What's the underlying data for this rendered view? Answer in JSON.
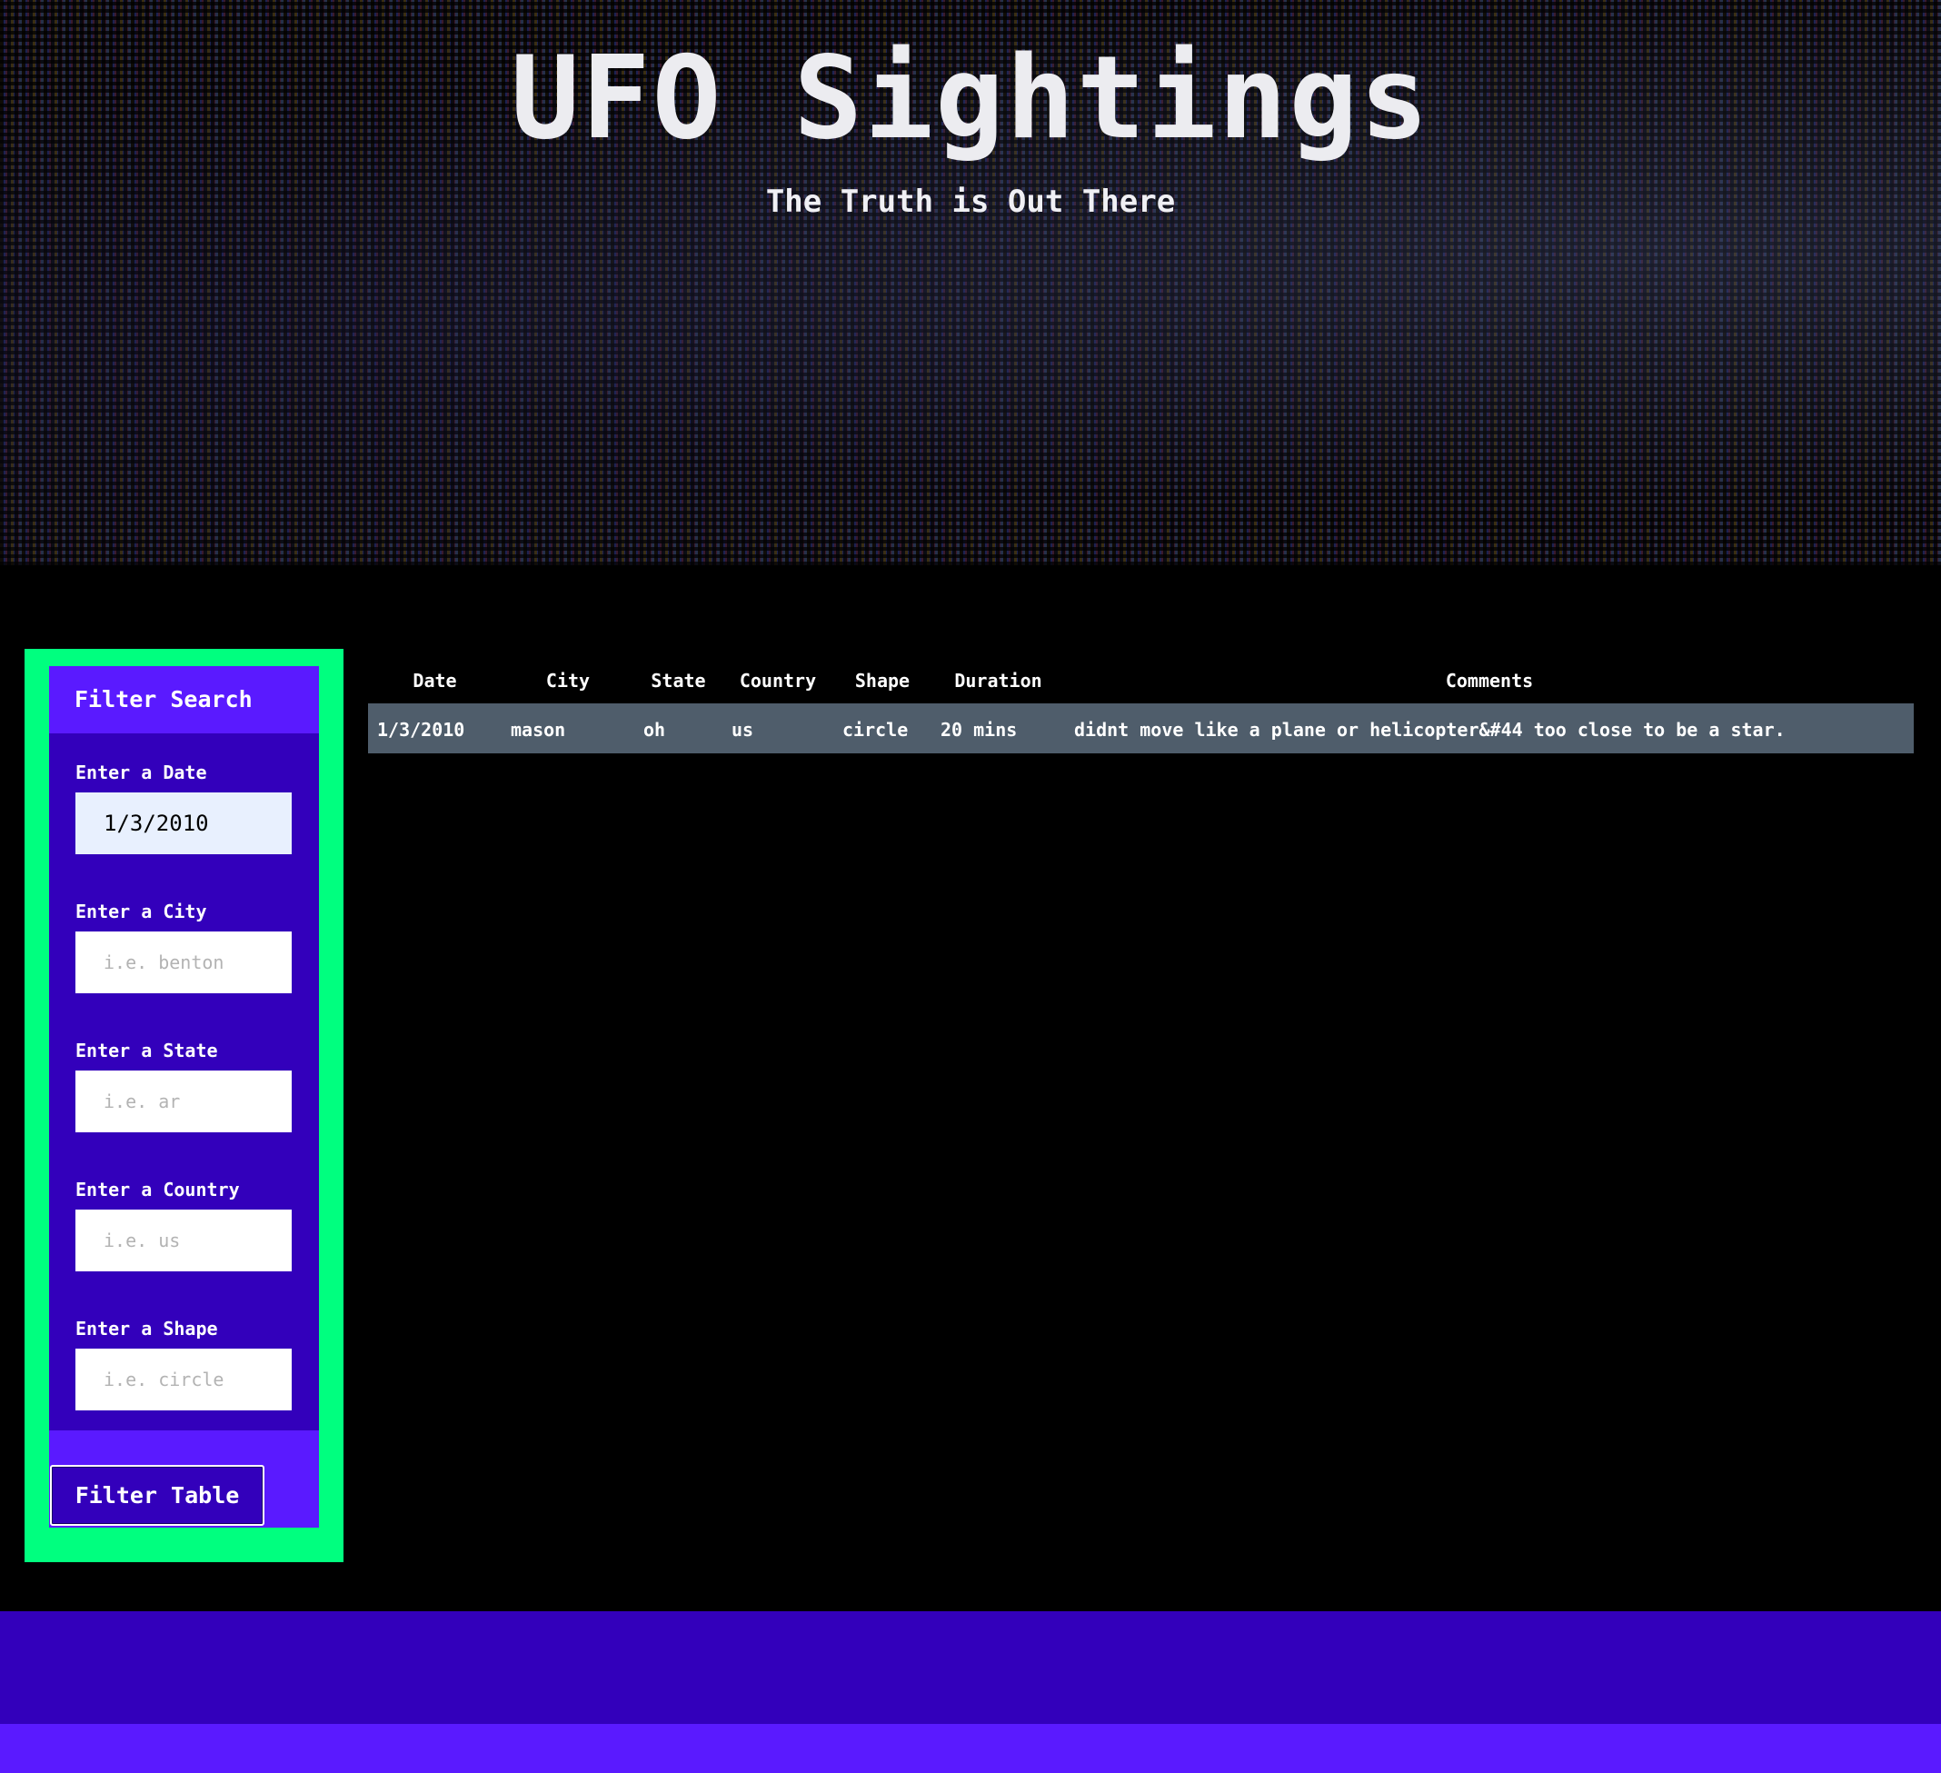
{
  "header": {
    "title": "UFO Sightings",
    "subtitle": "The Truth is Out There"
  },
  "filter": {
    "heading": "Filter Search",
    "fields": [
      {
        "label": "Enter a Date",
        "value": "1/3/2010",
        "placeholder": ""
      },
      {
        "label": "Enter a City",
        "value": "",
        "placeholder": "i.e. benton"
      },
      {
        "label": "Enter a State",
        "value": "",
        "placeholder": "i.e. ar"
      },
      {
        "label": "Enter a Country",
        "value": "",
        "placeholder": "i.e. us"
      },
      {
        "label": "Enter a Shape",
        "value": "",
        "placeholder": "i.e. circle"
      }
    ],
    "button_label": "Filter Table"
  },
  "table": {
    "columns": [
      "Date",
      "City",
      "State",
      "Country",
      "Shape",
      "Duration",
      "Comments"
    ],
    "rows": [
      [
        "1/3/2010",
        "mason",
        "oh",
        "us",
        "circle",
        "20 mins",
        "didnt move like a plane or helicopter&#44 too close to be a star."
      ]
    ]
  },
  "colors": {
    "accent_green": "#00ff7f",
    "panel_purple": "#3300bb",
    "highlight_purple": "#5a1aff",
    "row_gray": "#4f5d6b"
  }
}
